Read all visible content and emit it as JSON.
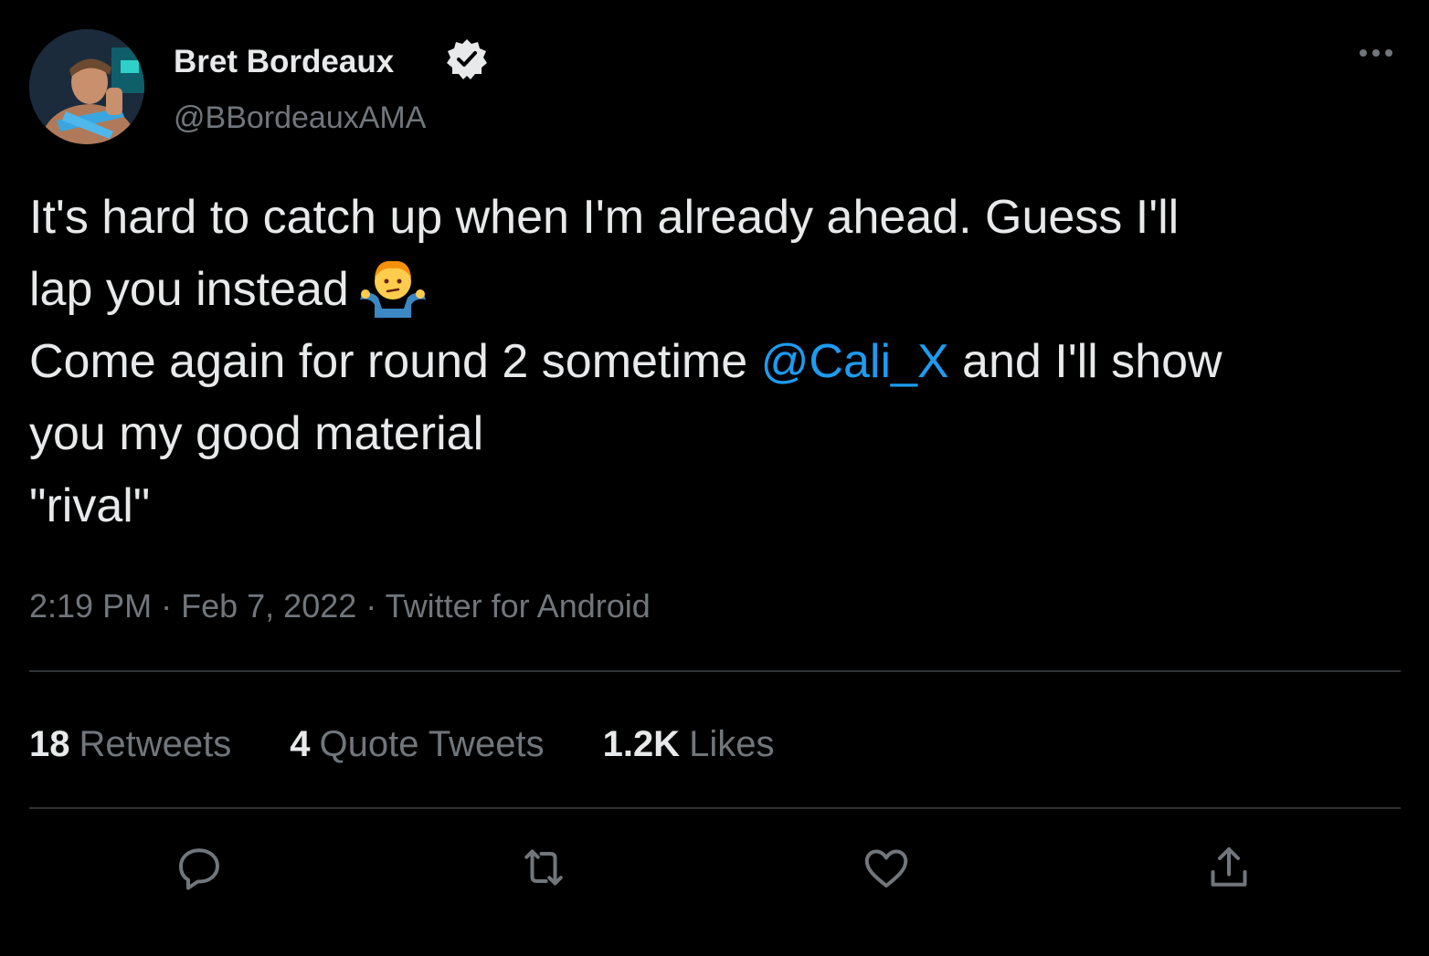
{
  "author": {
    "name": "Bret Bordeaux",
    "handle": "@BBordeauxAMA",
    "verified": true
  },
  "more_icon": "more-horizontal-icon",
  "tweet": {
    "line1": "It's hard to catch up when I'm already ahead. Guess I'll",
    "line2": "lap you instead",
    "line2_emoji": "person-shrugging-emoji",
    "line3_before": "Come again for round 2 sometime ",
    "line3_mention": "@Cali_X",
    "line3_after": " and I'll show",
    "line4": "you my good material",
    "line5": "\"rival\""
  },
  "meta": {
    "time": "2:19 PM",
    "separator": "·",
    "date": "Feb 7, 2022",
    "source": "Twitter for Android"
  },
  "stats": [
    {
      "count": "18",
      "label": "Retweets"
    },
    {
      "count": "4",
      "label": "Quote Tweets"
    },
    {
      "count": "1.2K",
      "label": "Likes"
    }
  ],
  "actions": [
    "reply-icon",
    "retweet-icon",
    "like-icon",
    "share-icon"
  ],
  "colors": {
    "background": "#000000",
    "text": "#e7e9ea",
    "secondary": "#71767b",
    "link": "#1d9bf0",
    "divider": "#2f3336"
  }
}
